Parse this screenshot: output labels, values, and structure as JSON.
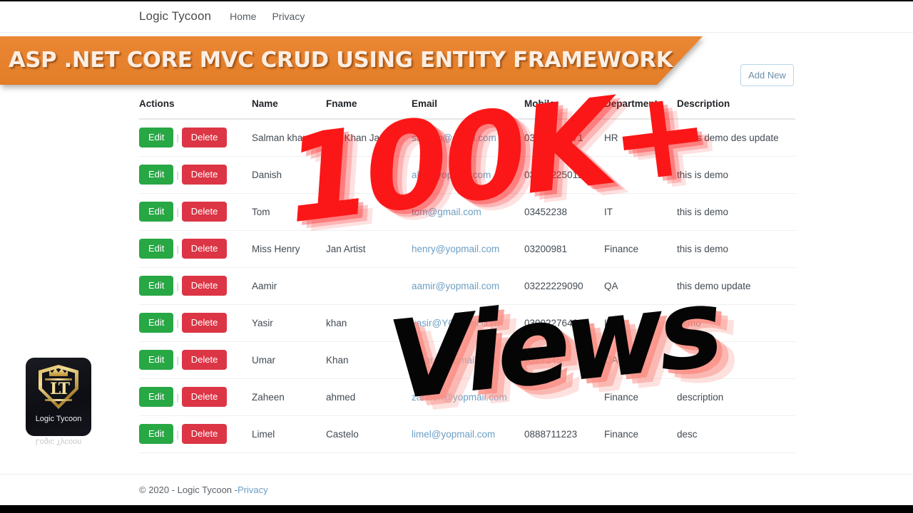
{
  "navbar": {
    "brand": "Logic Tycoon",
    "links": [
      {
        "label": "Home"
      },
      {
        "label": "Privacy"
      }
    ]
  },
  "banner": {
    "title": "ASP .NET CORE MVC CRUD USING ENTITY FRAMEWORK",
    "background_color": "#e8812f",
    "text_color": "#fdeee3"
  },
  "toolbar": {
    "add_new_label": "Add New",
    "add_new_border_color": "#b9d6e8",
    "add_new_text_color": "#6a8fa8"
  },
  "table": {
    "columns": [
      {
        "key": "actions",
        "label": "Actions"
      },
      {
        "key": "name",
        "label": "Name"
      },
      {
        "key": "fname",
        "label": "Fname"
      },
      {
        "key": "email",
        "label": "Email"
      },
      {
        "key": "mobile",
        "label": "Mobile"
      },
      {
        "key": "department",
        "label": "Department"
      },
      {
        "key": "description",
        "label": "Description"
      }
    ],
    "row_actions": {
      "edit_label": "Edit",
      "separator": "|",
      "delete_label": "Delete",
      "edit_color": "#28a745",
      "delete_color": "#dc3545"
    },
    "rows": [
      {
        "name": "Salman khan",
        "fname": "Jan Khan Jamali",
        "email": "salman@gmail.com",
        "mobile": "03457860171",
        "department": "HR",
        "description": "this is demo des update"
      },
      {
        "name": "Danish",
        "fname": "",
        "email": "abc@yopmail.com",
        "mobile": "03222225012",
        "department": "",
        "description": "this is demo"
      },
      {
        "name": "Tom",
        "fname": "Jan",
        "email": "tom@gmail.com",
        "mobile": "03452238",
        "department": "IT",
        "description": "this is demo"
      },
      {
        "name": "Miss Henry",
        "fname": "Jan Artist",
        "email": "henry@yopmail.com",
        "mobile": "03200981",
        "department": "Finance",
        "description": "this is demo"
      },
      {
        "name": "Aamir",
        "fname": "",
        "email": "aamir@yopmail.com",
        "mobile": "03222229090",
        "department": "QA",
        "description": "this demo update"
      },
      {
        "name": "Yasir",
        "fname": "khan",
        "email": "yasir@YOpmail.com",
        "mobile": "03002276483",
        "department": "IT",
        "description": "demo"
      },
      {
        "name": "Umar",
        "fname": "Khan",
        "email": "umar@yopmail.com",
        "mobile": "0322245",
        "department": "QA",
        "description": ""
      },
      {
        "name": "Zaheen",
        "fname": "ahmed",
        "email": "zaheen@yopmail.com",
        "mobile": "",
        "department": "Finance",
        "description": "description"
      },
      {
        "name": "Limel",
        "fname": "Castelo",
        "email": "limel@yopmail.com",
        "mobile": "0888711223",
        "department": "Finance",
        "description": "desc"
      }
    ]
  },
  "footer": {
    "copyright": "© 2020 - Logic Tycoon - ",
    "privacy_label": "Privacy"
  },
  "watermarks": {
    "views_count": "100K+",
    "views_word": "Views",
    "count_color": "#fb1717",
    "word_color": "#050505"
  },
  "logo": {
    "monogram": "LT",
    "name": "Logic Tycoon",
    "reflection": "Logic Tycoon"
  }
}
